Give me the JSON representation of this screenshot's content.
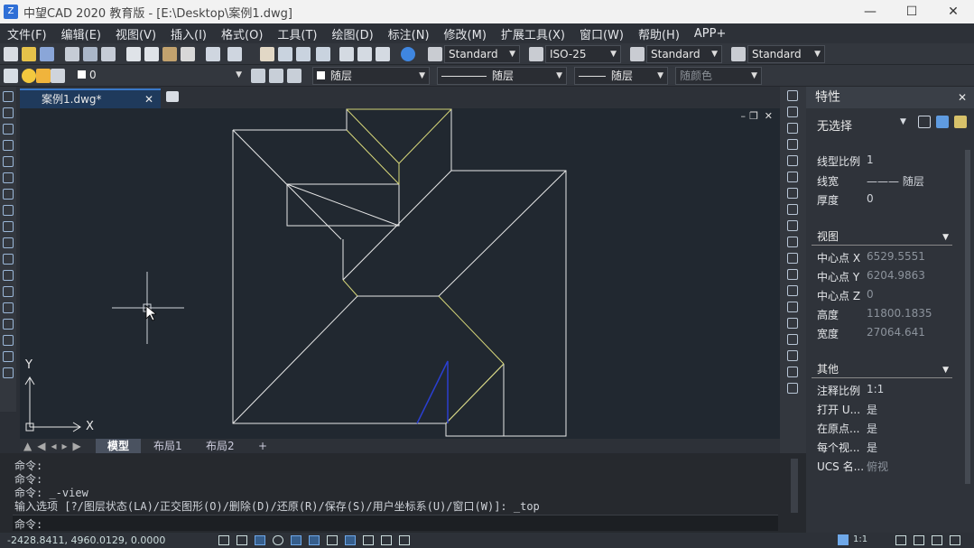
{
  "app": {
    "title": "中望CAD 2020 教育版 - [E:\\Desktop\\案例1.dwg]",
    "logo_text": "Z",
    "window_controls": {
      "minimize": "—",
      "maximize": "☐",
      "close": "✕"
    }
  },
  "menu": [
    "文件(F)",
    "编辑(E)",
    "视图(V)",
    "插入(I)",
    "格式(O)",
    "工具(T)",
    "绘图(D)",
    "标注(N)",
    "修改(M)",
    "扩展工具(X)",
    "窗口(W)",
    "帮助(H)",
    "APP+"
  ],
  "toolbar1": {
    "text_style": "Standard",
    "dim_style": "ISO-25",
    "table_style": "Standard",
    "mleader_style": "Standard"
  },
  "toolbar2": {
    "layer": "0",
    "color": "随层",
    "linetype": "随层",
    "lineweight": "随层",
    "plotstyle": "随颜色"
  },
  "document_tab": {
    "name": "案例1.dwg*",
    "close": "✕"
  },
  "canvas": {
    "axis_x": "X",
    "axis_y": "Y",
    "win_min": "–",
    "win_restore": "❐",
    "win_close": "✕"
  },
  "layout_tabs": [
    "模型",
    "布局1",
    "布局2",
    "+"
  ],
  "command": {
    "lines": [
      "命令:",
      "命令:",
      "命令: _-view",
      "输入选项 [?/图层状态(LA)/正交图形(O)/删除(D)/还原(R)/保存(S)/用户坐标系(U)/窗口(W)]: _top"
    ],
    "prompt": "命令:"
  },
  "status": {
    "coords": "-2428.8411, 4960.0129, 0.0000",
    "scale": "1:1"
  },
  "properties": {
    "header": "特性",
    "selection": "无选择",
    "general": [
      {
        "label": "线型比例",
        "value": "1"
      },
      {
        "label": "线宽",
        "value": "——— 随层"
      },
      {
        "label": "厚度",
        "value": "0"
      }
    ],
    "view_section": "视图",
    "view": [
      {
        "label": "中心点 X",
        "value": "6529.5551"
      },
      {
        "label": "中心点 Y",
        "value": "6204.9863"
      },
      {
        "label": "中心点 Z",
        "value": "0"
      },
      {
        "label": "高度",
        "value": "11800.1835"
      },
      {
        "label": "宽度",
        "value": "27064.641"
      }
    ],
    "misc_section": "其他",
    "misc": [
      {
        "label": "注释比例",
        "value": "1:1"
      },
      {
        "label": "打开 U...",
        "value": "是"
      },
      {
        "label": "在原点...",
        "value": "是"
      },
      {
        "label": "每个视...",
        "value": "是"
      },
      {
        "label": "UCS 名...",
        "value": "俯视"
      }
    ]
  },
  "colors": {
    "canvas_bg": "#212830",
    "line_white": "#e8e8e8",
    "line_yellow": "#d8d87a",
    "line_blue": "#2a3fd0",
    "accent": "#3a78c8"
  }
}
